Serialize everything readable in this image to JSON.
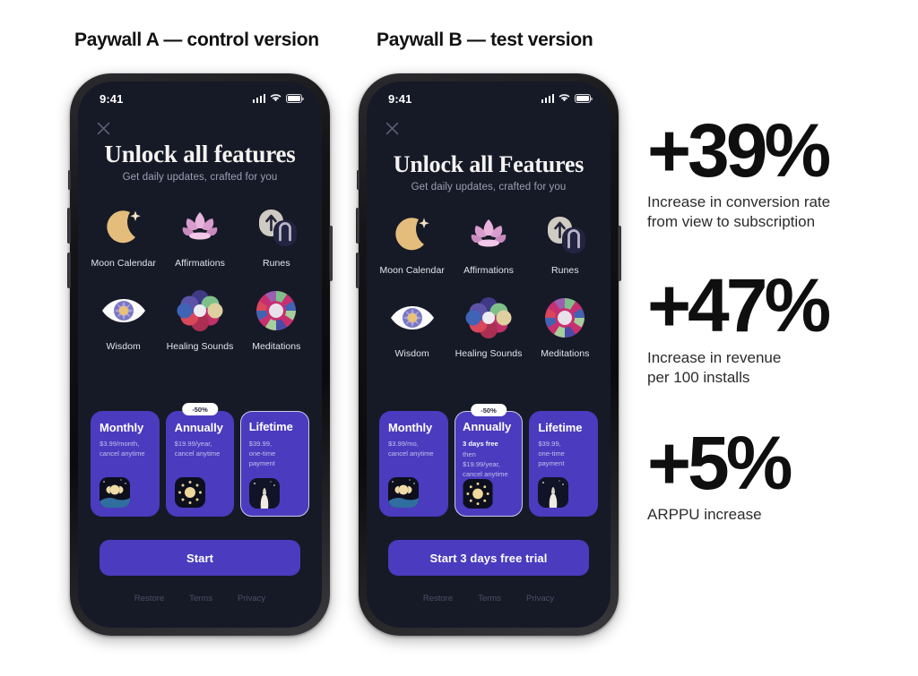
{
  "captions": {
    "a": "Paywall A — control version",
    "b": "Paywall B — test version"
  },
  "colors": {
    "screen_bg": "#161a27",
    "accent_purple": "#4a3bbf",
    "plan_text_muted": "#c4bdea",
    "stat_text": "#100f10"
  },
  "paywall_a": {
    "status": {
      "time": "9:41",
      "signal_icon": "signal-bars-icon",
      "wifi_icon": "wifi-icon",
      "battery_icon": "battery-icon"
    },
    "close_icon": "close-icon",
    "title": "Unlock all features",
    "subtitle": "Get daily updates, crafted for you",
    "features": [
      {
        "label": "Moon Calendar",
        "icon": "moon-crescent-icon"
      },
      {
        "label": "Affirmations",
        "icon": "lotus-flower-icon"
      },
      {
        "label": "Runes",
        "icon": "runes-stones-icon"
      },
      {
        "label": "Wisdom",
        "icon": "eye-wisdom-icon"
      },
      {
        "label": "Healing Sounds",
        "icon": "healing-flower-icon"
      },
      {
        "label": "Meditations",
        "icon": "meditation-mandala-icon"
      }
    ],
    "plans": [
      {
        "name": "Monthly",
        "desc": "$3.99/month,\ncancel anytime",
        "selected": false,
        "badge": "",
        "art": "moon-phases-art"
      },
      {
        "name": "Annually",
        "desc": "$19.99/year,\ncancel anytime",
        "selected": false,
        "badge": "-50%",
        "art": "sun-zodiac-art"
      },
      {
        "name": "Lifetime",
        "desc": "$39.99,\none-time payment",
        "selected": true,
        "badge": "",
        "art": "crystal-hand-art"
      }
    ],
    "cta": "Start",
    "legal": [
      "Restore",
      "Terms",
      "Privacy"
    ]
  },
  "paywall_b": {
    "status": {
      "time": "9:41",
      "signal_icon": "signal-bars-icon",
      "wifi_icon": "wifi-icon",
      "battery_icon": "battery-icon"
    },
    "close_icon": "close-icon",
    "title": "Unlock all Features",
    "subtitle": "Get daily updates, crafted for you",
    "features": [
      {
        "label": "Moon Calendar",
        "icon": "moon-crescent-icon"
      },
      {
        "label": "Affirmations",
        "icon": "lotus-flower-icon"
      },
      {
        "label": "Runes",
        "icon": "runes-stones-icon"
      },
      {
        "label": "Wisdom",
        "icon": "eye-wisdom-icon"
      },
      {
        "label": "Healing Sounds",
        "icon": "healing-flower-icon"
      },
      {
        "label": "Meditations",
        "icon": "meditation-mandala-icon"
      }
    ],
    "plans": [
      {
        "name": "Monthly",
        "desc": "$3.99/mo,\ncancel anytime",
        "selected": false,
        "badge": "",
        "art": "moon-phases-art"
      },
      {
        "name": "Annually",
        "desc_highlight": "3 days free",
        "desc": "then $19.99/year,\ncancel anytime",
        "selected": true,
        "badge": "-50%",
        "art": "sun-zodiac-art"
      },
      {
        "name": "Lifetime",
        "desc": "$39.99,\none-time payment",
        "selected": false,
        "badge": "",
        "art": "crystal-hand-art"
      }
    ],
    "cta": "Start 3 days free trial",
    "legal": [
      "Restore",
      "Terms",
      "Privacy"
    ]
  },
  "stats": [
    {
      "value": "+39%",
      "description": "Increase in conversion rate\nfrom view to subscription"
    },
    {
      "value": "+47%",
      "description": "Increase in revenue\nper 100 installs"
    },
    {
      "value": "+5%",
      "description": "ARPPU increase"
    }
  ]
}
